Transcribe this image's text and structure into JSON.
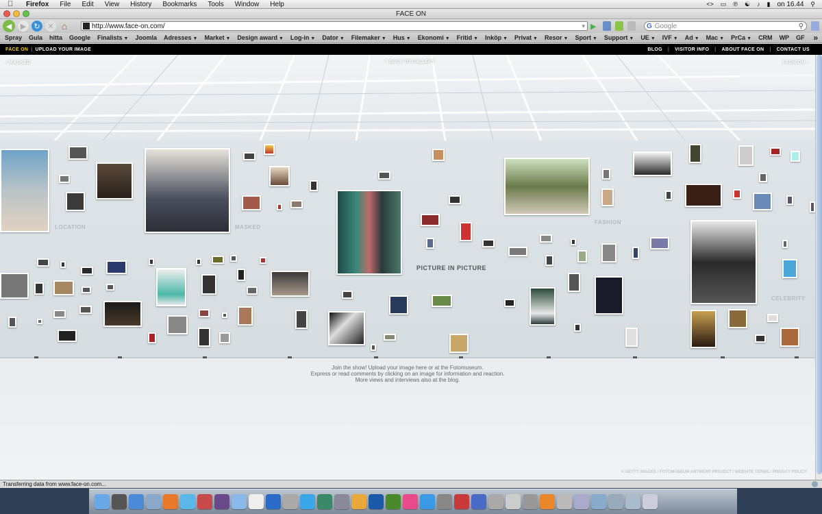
{
  "menubar": {
    "apple": "",
    "items": [
      "Firefox",
      "File",
      "Edit",
      "View",
      "History",
      "Bookmarks",
      "Tools",
      "Window",
      "Help"
    ],
    "clock": "on 16.44"
  },
  "window": {
    "title": "FACE ON"
  },
  "toolbar": {
    "url": "http://www.face-on.com/",
    "search_placeholder": "Google"
  },
  "bookmarks": [
    {
      "label": "Spray",
      "menu": false
    },
    {
      "label": "Gula",
      "menu": false
    },
    {
      "label": "hitta",
      "menu": false
    },
    {
      "label": "Google",
      "menu": false
    },
    {
      "label": "Finalists",
      "menu": true
    },
    {
      "label": "Joomla",
      "menu": false
    },
    {
      "label": "Adresses",
      "menu": true
    },
    {
      "label": "Market",
      "menu": true
    },
    {
      "label": "Design award",
      "menu": true
    },
    {
      "label": "Log-in",
      "menu": true
    },
    {
      "label": "Dator",
      "menu": true
    },
    {
      "label": "Filemaker",
      "menu": true
    },
    {
      "label": "Hus",
      "menu": true
    },
    {
      "label": "Ekonomi",
      "menu": true
    },
    {
      "label": "Fritid",
      "menu": true
    },
    {
      "label": "Inköp",
      "menu": true
    },
    {
      "label": "Privat",
      "menu": true
    },
    {
      "label": "Resor",
      "menu": true
    },
    {
      "label": "Sport",
      "menu": true
    },
    {
      "label": "Support",
      "menu": true
    },
    {
      "label": "UE",
      "menu": true
    },
    {
      "label": "IVF",
      "menu": true
    },
    {
      "label": "Ad",
      "menu": true
    },
    {
      "label": "Mac",
      "menu": true
    },
    {
      "label": "PrCa",
      "menu": true
    },
    {
      "label": "CRM",
      "menu": false
    },
    {
      "label": "WP",
      "menu": false
    },
    {
      "label": "GF",
      "menu": false
    }
  ],
  "site": {
    "brand": "FACE ON",
    "upload": "UPLOAD YOUR IMAGE",
    "links": [
      "BLOG",
      "VISITOR INFO",
      "ABOUT FACE ON",
      "CONTACT US"
    ],
    "nav_left": "MASKED",
    "nav_center": "BACK TO GALLERY",
    "nav_right": "FASHION",
    "wall_labels": {
      "location": "LOCATION",
      "masked": "MASKED",
      "picture_in_picture": "PICTURE IN PICTURE",
      "fashion": "FASHION",
      "celebrity": "CELEBRITY"
    },
    "caption": [
      "Join the show! Upload your image here or at the Fotomuseum.",
      "Express or read comments by clicking on an image for information and reaction.",
      "More views and interviews also at the blog."
    ],
    "footer": "© GETTY IMAGES / FOTOMUSEUM ANTWERP PROJECT / WEBSITE TERMS / PRIVACY POLICY"
  },
  "status": {
    "text": "Transferring data from www.face-on.com..."
  },
  "dock": {
    "apps": [
      "Finder",
      "Dashboard",
      "Safari",
      "Mail",
      "Firefox",
      "iTunes",
      "Photo Booth",
      "iMovie",
      "Preview",
      "TextEdit",
      "Internet Explorer",
      "Screen",
      "Skype",
      "Time Machine",
      "Xcode",
      "Garage",
      "Photoshop",
      "Dreamweaver",
      "Contribute",
      "Fireworks",
      "Calculator",
      "Flash",
      "Keynote",
      "Script Editor",
      "Database",
      "DiskUtil",
      "VLC",
      "Help",
      "Network",
      "Folder",
      "Documents",
      "Downloads",
      "Trash"
    ]
  }
}
